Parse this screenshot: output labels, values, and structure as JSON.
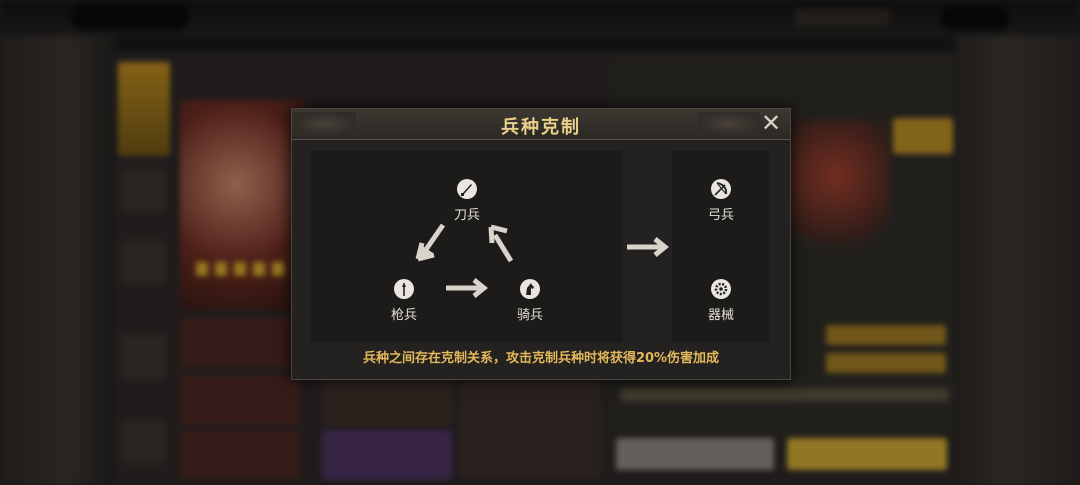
{
  "dialog": {
    "title": "兵种克制",
    "close_icon": "close-icon",
    "hint": "兵种之间存在克制关系，攻击克制兵种时将获得20%伤害加成"
  },
  "triangle": {
    "blade": {
      "label": "刀兵",
      "icon": "blade-icon"
    },
    "spear": {
      "label": "枪兵",
      "icon": "spear-icon"
    },
    "cavalry": {
      "label": "骑兵",
      "icon": "horse-icon"
    }
  },
  "side": {
    "archer": {
      "label": "弓兵",
      "icon": "bow-icon"
    },
    "siege": {
      "label": "器械",
      "icon": "gear-icon"
    }
  },
  "colors": {
    "title": "#e9cf8a",
    "hint": "#e3b75b",
    "arrow": "#d8d4cc"
  }
}
